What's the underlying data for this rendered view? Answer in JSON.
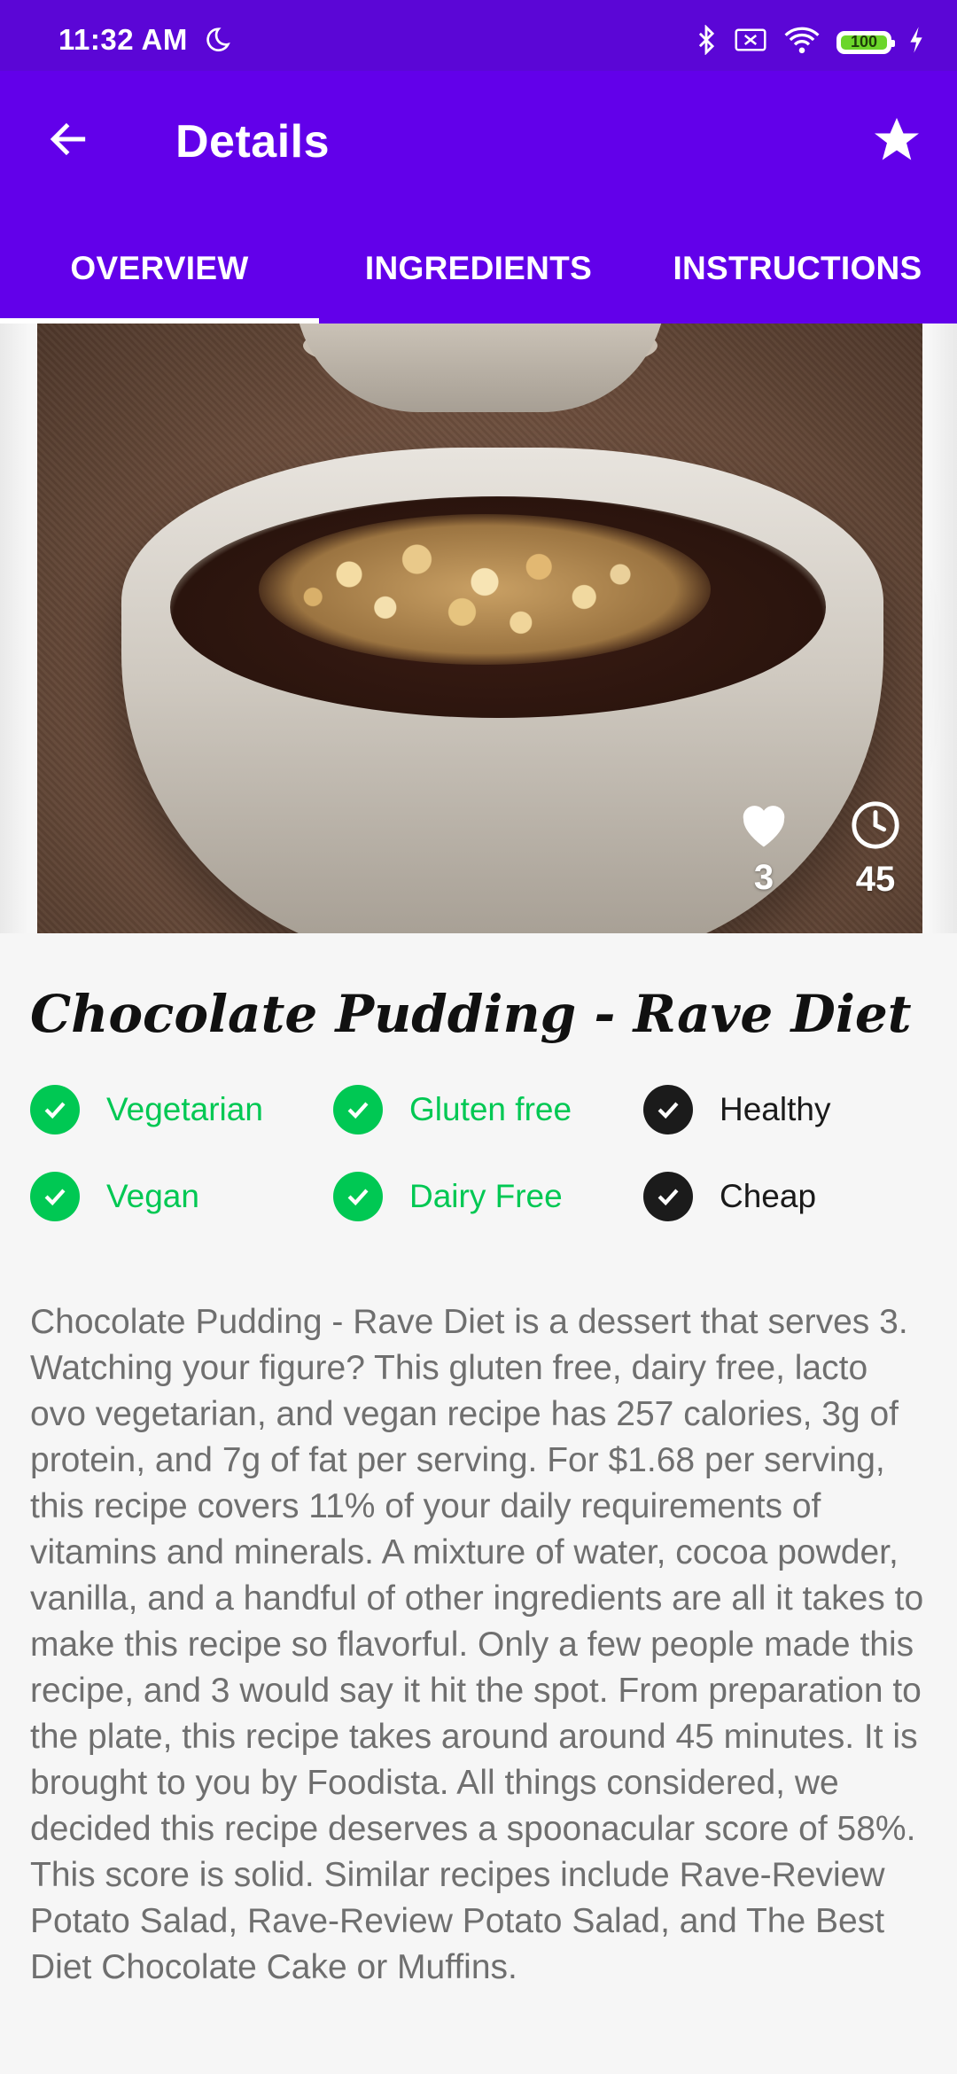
{
  "status_bar": {
    "time": "11:32 AM",
    "battery": "100",
    "icons": [
      "moon-icon",
      "bluetooth-icon",
      "no-sim-icon",
      "wifi-icon",
      "battery-icon",
      "charging-icon"
    ]
  },
  "app_bar": {
    "title": "Details",
    "back_icon": "arrow-left",
    "favorite_icon": "star"
  },
  "tabs": [
    {
      "label": "OVERVIEW",
      "active": true
    },
    {
      "label": "INGREDIENTS",
      "active": false
    },
    {
      "label": "INSTRUCTIONS",
      "active": false
    }
  ],
  "hero": {
    "likes": "3",
    "minutes": "45"
  },
  "recipe": {
    "title": "Chocolate Pudding - Rave Diet",
    "badges": [
      {
        "label": "Vegetarian",
        "state": "active"
      },
      {
        "label": "Gluten free",
        "state": "active"
      },
      {
        "label": "Healthy",
        "state": "inactive"
      },
      {
        "label": "Vegan",
        "state": "active"
      },
      {
        "label": "Dairy Free",
        "state": "active"
      },
      {
        "label": "Cheap",
        "state": "inactive"
      }
    ],
    "summary": "Chocolate Pudding - Rave Diet is a dessert that serves 3. Watching your figure? This gluten free, dairy free, lacto ovo vegetarian, and vegan recipe has 257 calories, 3g of protein, and 7g of fat per serving. For $1.68 per serving, this recipe covers 11% of your daily requirements of vitamins and minerals. A mixture of water, cocoa powder, vanilla, and a handful of other ingredients are all it takes to make this recipe so flavorful. Only a few people made this recipe, and 3 would say it hit the spot. From preparation to the plate, this recipe takes around around 45 minutes. It is brought to you by Foodista. All things considered, we decided this recipe deserves a spoonacular score of 58%. This score is solid. Similar recipes include Rave-Review Potato Salad, Rave-Review Potato Salad, and The Best Diet Chocolate Cake or Muffins."
  },
  "colors": {
    "status_bar": "#5b06d6",
    "app_bar": "#6200ea",
    "active_green": "#00c853",
    "inactive_dark": "#1b1b1b",
    "summary_text": "#6f6f6f"
  }
}
